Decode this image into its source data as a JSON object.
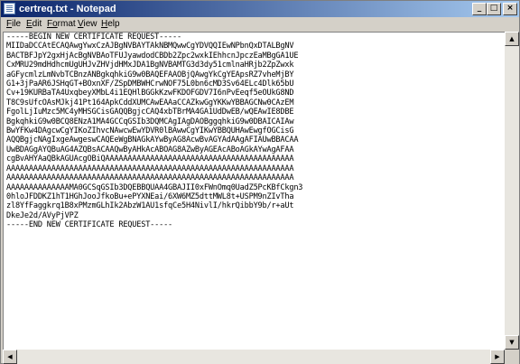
{
  "window": {
    "title": "certreq.txt - Notepad"
  },
  "titlebar_buttons": {
    "minimize": "_",
    "maximize": "□",
    "close": "×"
  },
  "menu": {
    "file": {
      "accel": "F",
      "rest": "ile"
    },
    "edit": {
      "accel": "E",
      "rest": "dit"
    },
    "format": {
      "accel": "Fo",
      "rest": "rmat"
    },
    "view": {
      "accel": "V",
      "rest": "iew"
    },
    "help": {
      "accel": "H",
      "rest": "elp"
    }
  },
  "editor": {
    "text": "-----BEGIN NEW CERTIFICATE REQUEST-----\nMIIDaDCCAtECAQAwgYwxCzAJBgNVBAYTAkNBMQwwCgYDVQQIEwNPbnQxDTALBgNV\nBACTBFJpY2gxHjAcBgNVBAoTFUJyawdodCBDb2Zpc2wxkIEhhcnJpczEaMBgGA1UE\nCxMRU29mdHdhcmUgUHJvZHVjdHMxJDA1BgNVBAMTG3d3dy51cmlnaHRjb2ZpZwxk\naGFycmlzLmNvbTCBnzANBgkqhkiG9w0BAQEFAAOBjQAwgYkCgYEApsRZ7vheMjBY\nG1+3jPaAR6JSHqGT+BOxnXF/ZSpDMBWHCrwNOF75L0bn6cMD3Sv64ELc4Dlk65bU\nCv+19KURBaTA4UxqbeyXMbL4i1EQHlBGGkKzwFKDOFGDV7I6nPvEeqf5eOUkG8ND\nT8C9sUfcOAsMJkj41Pt164ApkCddXUMCAwEAAaCCAZkwGgYKKwYBBAGCNw0CAzEM\nFgolLjIuMzc5MC4yMHSGCisGAQQBgjcCAQ4xbTBrMA4GA1UdDwEB/wQEAwIE8DBE\nBgkqhkiG9w0BCQ8ENzA1MA4GCCqGSIb3DQMCAgIAgDAOBggqhkiG9w0DBAICAIAw\nBwYFKw4DAgcwCgYIKoZIhvcNAwcwEwYDVR0lBAwwCgYIKwYBBQUHAwEwgfOGCisG\nAQQBgjcNAgIxgeAwgeswCAQEeWgBNAGkAYwByAG8AcwBvAGYAdAAgAFIAUwBBACAA\nUwBDAGgAYQBuAG4AZQBsACAAQwByAHkAcABOAG8AZwByAGEAcABoAGkAYwAgAFAA\ncgBvAHYAaQBkAGUAcgOBiQAAAAAAAAAAAAAAAAAAAAAAAAAAAAAAAAAAAAAAAAAA\nAAAAAAAAAAAAAAAAAAAAAAAAAAAAAAAAAAAAAAAAAAAAAAAAAAAAAAAAAAAAAAAA\nAAAAAAAAAAAAAAAAAAAAAAAAAAAAAAAAAAAAAAAAAAAAAAAAAAAAAAAAAAAAAAAA\nAAAAAAAAAAAAAAMA0GCSqGSIb3DQEBBQUAA4GBAJII0xFWnOmq0UadZ5PcKBfCkgn3\n0hloJFDDKZ1hT1HGhJooJfkoBu+ePYXNEai/6XW6MZ5dttMWL8t+USPM9nZIvTha\nzl8YfFaggkrq1B8xPMzmGLhIk2AbzW1AU1sfqCe5H4NivlI/hkrQibbY9b/r+aUt\nDkeJe2d/AVyPjVPZ\n-----END NEW CERTIFICATE REQUEST-----"
  },
  "scrollbar": {
    "up": "▲",
    "down": "▼",
    "left": "◀",
    "right": "▶"
  }
}
